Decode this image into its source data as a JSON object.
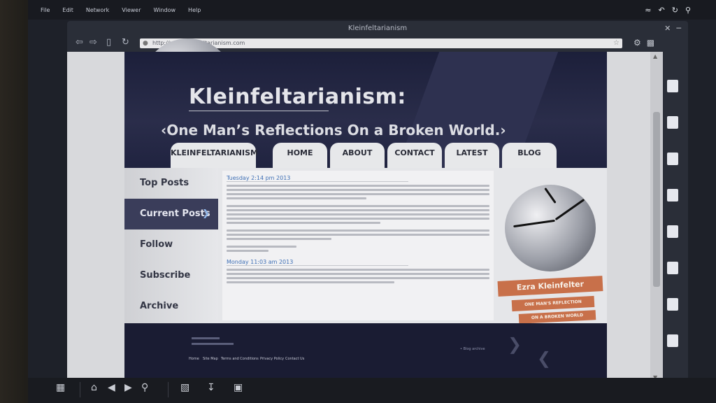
{
  "menu": [
    "File",
    "Edit",
    "Network",
    "Viewer",
    "Window",
    "Help"
  ],
  "window_title": "Kleinfeltarianism",
  "address_url": "http://www.kleinfeltarianism.com",
  "site": {
    "title": "Kleinfeltarianism:",
    "subtitle": "‹One Man’s Reflections On a Broken World.›",
    "tabs": [
      "KLEINFELTARIANISM",
      "HOME",
      "ABOUT",
      "CONTACT",
      "LATEST",
      "BLOG"
    ],
    "sidebar": [
      "Top Posts",
      "Current Posts",
      "Follow",
      "Subscribe",
      "Archive"
    ],
    "posts": [
      {
        "date": "Tuesday 2:14 pm 2013"
      },
      {
        "date": "Monday 11:03 am 2013"
      }
    ],
    "ribbons": [
      "Ezra Kleinfelter",
      "ONE MAN'S REFLECTION",
      "ON A BROKEN WORLD"
    ],
    "footer_links": [
      "Home",
      "Site Map",
      "Terms and Conditions",
      "Privacy Policy",
      "Contact Us"
    ],
    "footer_note": "• Blog archive"
  },
  "colors": {
    "header_bg": "#1c1f3a",
    "ribbon": "#c8704a",
    "accent_link": "#3e6fb5"
  }
}
